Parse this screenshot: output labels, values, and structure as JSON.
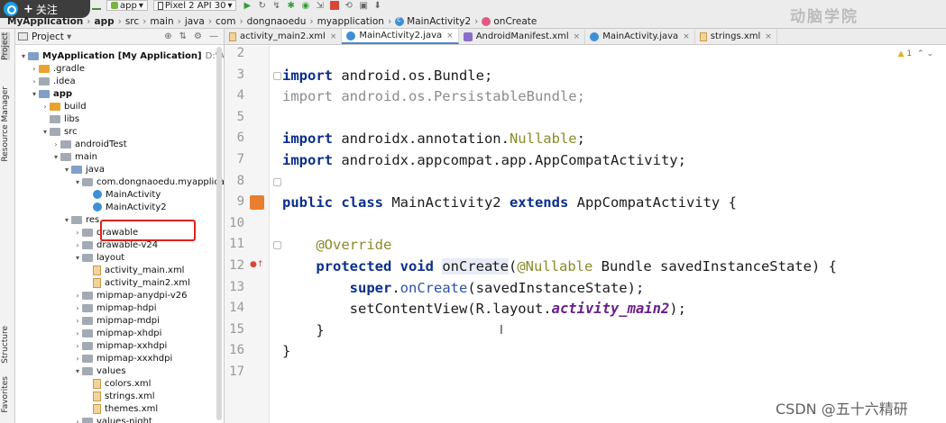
{
  "follow_overlay": {
    "label": "关注",
    "plus": "+"
  },
  "watermark_top": "动脑学院",
  "watermark_bottom": "CSDN @五十六精研",
  "breadcrumb": [
    "MyApplication",
    "app",
    "src",
    "main",
    "java",
    "com",
    "dongnaoedu",
    "myapplication",
    "MainActivity2",
    "onCreate"
  ],
  "toolbar": {
    "config": "app",
    "device": "Pixel 2 API 30"
  },
  "left_stripe": [
    "Project",
    "Resource Manager",
    "Structure",
    "Favorites"
  ],
  "project_panel": {
    "view_selector": "Project",
    "tree": [
      {
        "label": "MyApplication [My Application]",
        "hint": "D:\\Android\\Andr",
        "depth": 0,
        "expanded": true,
        "icon": "folder-blue",
        "bold": false
      },
      {
        "label": ".gradle",
        "depth": 1,
        "expanded": false,
        "icon": "folder-orange"
      },
      {
        "label": ".idea",
        "depth": 1,
        "expanded": false,
        "icon": "folder"
      },
      {
        "label": "app",
        "depth": 1,
        "expanded": true,
        "icon": "folder-blue",
        "bold": true
      },
      {
        "label": "build",
        "depth": 2,
        "expanded": false,
        "icon": "folder-orange"
      },
      {
        "label": "libs",
        "depth": 2,
        "expanded": null,
        "icon": "folder"
      },
      {
        "label": "src",
        "depth": 2,
        "expanded": true,
        "icon": "folder"
      },
      {
        "label": "androidTest",
        "depth": 3,
        "expanded": false,
        "icon": "folder"
      },
      {
        "label": "main",
        "depth": 3,
        "expanded": true,
        "icon": "folder"
      },
      {
        "label": "java",
        "depth": 4,
        "expanded": true,
        "icon": "folder-blue"
      },
      {
        "label": "com.dongnaoedu.myapplication",
        "depth": 5,
        "expanded": true,
        "icon": "folder"
      },
      {
        "label": "MainActivity",
        "depth": 6,
        "expanded": null,
        "icon": "class"
      },
      {
        "label": "MainActivity2",
        "depth": 6,
        "expanded": null,
        "icon": "class"
      },
      {
        "label": "res",
        "depth": 4,
        "expanded": true,
        "icon": "folder"
      },
      {
        "label": "drawable",
        "depth": 5,
        "expanded": false,
        "icon": "folder"
      },
      {
        "label": "drawable-v24",
        "depth": 5,
        "expanded": false,
        "icon": "folder"
      },
      {
        "label": "layout",
        "depth": 5,
        "expanded": true,
        "icon": "folder"
      },
      {
        "label": "activity_main.xml",
        "depth": 6,
        "expanded": null,
        "icon": "xml"
      },
      {
        "label": "activity_main2.xml",
        "depth": 6,
        "expanded": null,
        "icon": "xml"
      },
      {
        "label": "mipmap-anydpi-v26",
        "depth": 5,
        "expanded": false,
        "icon": "folder"
      },
      {
        "label": "mipmap-hdpi",
        "depth": 5,
        "expanded": false,
        "icon": "folder"
      },
      {
        "label": "mipmap-mdpi",
        "depth": 5,
        "expanded": false,
        "icon": "folder"
      },
      {
        "label": "mipmap-xhdpi",
        "depth": 5,
        "expanded": false,
        "icon": "folder"
      },
      {
        "label": "mipmap-xxhdpi",
        "depth": 5,
        "expanded": false,
        "icon": "folder"
      },
      {
        "label": "mipmap-xxxhdpi",
        "depth": 5,
        "expanded": false,
        "icon": "folder"
      },
      {
        "label": "values",
        "depth": 5,
        "expanded": true,
        "icon": "folder"
      },
      {
        "label": "colors.xml",
        "depth": 6,
        "expanded": null,
        "icon": "xml"
      },
      {
        "label": "strings.xml",
        "depth": 6,
        "expanded": null,
        "icon": "xml"
      },
      {
        "label": "themes.xml",
        "depth": 6,
        "expanded": null,
        "icon": "xml"
      },
      {
        "label": "values-night",
        "depth": 5,
        "expanded": false,
        "icon": "folder"
      }
    ]
  },
  "tabs": [
    {
      "label": "activity_main2.xml",
      "icon": "xml",
      "active": false
    },
    {
      "label": "MainActivity2.java",
      "icon": "class",
      "active": true
    },
    {
      "label": "AndroidManifest.xml",
      "icon": "manifest",
      "active": false
    },
    {
      "label": "MainActivity.java",
      "icon": "class",
      "active": false
    },
    {
      "label": "strings.xml",
      "icon": "xml",
      "active": false
    }
  ],
  "editor": {
    "warning_count": "1",
    "line_numbers": [
      "2",
      "3",
      "4",
      "5",
      "6",
      "7",
      "8",
      "9",
      "10",
      "11",
      "12",
      "13",
      "14",
      "15",
      "16",
      "17"
    ],
    "lines": [
      {
        "n": "2",
        "tokens": []
      },
      {
        "n": "3",
        "tokens": [
          {
            "t": "import",
            "c": "kw"
          },
          {
            "t": " android.os.Bundle;",
            "c": ""
          }
        ]
      },
      {
        "n": "4",
        "tokens": [
          {
            "t": "import android.os.PersistableBundle;",
            "c": "gray"
          }
        ]
      },
      {
        "n": "5",
        "tokens": []
      },
      {
        "n": "6",
        "tokens": [
          {
            "t": "import",
            "c": "kw"
          },
          {
            "t": " androidx.annotation.",
            "c": ""
          },
          {
            "t": "Nullable",
            "c": "ann"
          },
          {
            "t": ";",
            "c": ""
          }
        ]
      },
      {
        "n": "7",
        "tokens": [
          {
            "t": "import",
            "c": "kw"
          },
          {
            "t": " androidx.appcompat.app.AppCompatActivity;",
            "c": ""
          }
        ]
      },
      {
        "n": "8",
        "tokens": []
      },
      {
        "n": "9",
        "tokens": [
          {
            "t": "public class",
            "c": "kw"
          },
          {
            "t": " MainActivity2 ",
            "c": ""
          },
          {
            "t": "extends",
            "c": "kw"
          },
          {
            "t": " AppCompatActivity {",
            "c": ""
          }
        ]
      },
      {
        "n": "10",
        "tokens": []
      },
      {
        "n": "11",
        "tokens": [
          {
            "t": "    @Override",
            "c": "ann"
          }
        ]
      },
      {
        "n": "12",
        "tokens": [
          {
            "t": "    ",
            "c": ""
          },
          {
            "t": "protected void",
            "c": "kw"
          },
          {
            "t": " ",
            "c": ""
          },
          {
            "t": "onCrea",
            "c": "hl"
          },
          {
            "t": "|",
            "c": "caret"
          },
          {
            "t": "te",
            "c": "hl"
          },
          {
            "t": "(",
            "c": ""
          },
          {
            "t": "@Nullable",
            "c": "ann"
          },
          {
            "t": " Bundle savedInstanceState) {",
            "c": ""
          }
        ]
      },
      {
        "n": "13",
        "tokens": [
          {
            "t": "        ",
            "c": ""
          },
          {
            "t": "super",
            "c": "kw"
          },
          {
            "t": ".",
            "c": ""
          },
          {
            "t": "onCreate",
            "c": "call"
          },
          {
            "t": "(savedInstanceState);",
            "c": ""
          }
        ]
      },
      {
        "n": "14",
        "tokens": [
          {
            "t": "        setContentView(R.layout.",
            "c": ""
          },
          {
            "t": "activity_main2",
            "c": "res"
          },
          {
            "t": ");",
            "c": ""
          }
        ]
      },
      {
        "n": "15",
        "tokens": [
          {
            "t": "    }",
            "c": ""
          }
        ]
      },
      {
        "n": "16",
        "tokens": [
          {
            "t": "}",
            "c": ""
          }
        ]
      },
      {
        "n": "17",
        "tokens": []
      }
    ]
  }
}
